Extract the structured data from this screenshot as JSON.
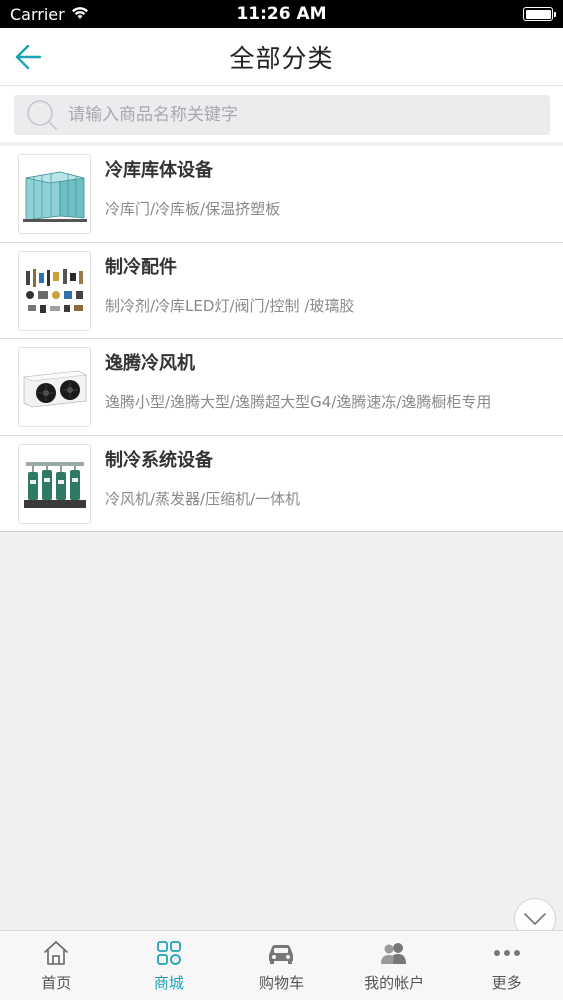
{
  "status_bar": {
    "carrier": "Carrier",
    "time": "11:26 AM"
  },
  "nav": {
    "title": "全部分类"
  },
  "search": {
    "placeholder": "请输入商品名称关键字"
  },
  "categories": [
    {
      "name": "冷库库体设备",
      "sub": "冷库门/冷库板/保温挤塑板",
      "icon": "cold-room-panels-image"
    },
    {
      "name": "制冷配件",
      "sub": "制冷剂/冷库LED灯/阀门/控制 /玻璃胶",
      "icon": "refrigeration-parts-image"
    },
    {
      "name": "逸腾冷风机",
      "sub": "逸腾小型/逸腾大型/逸腾超大型G4/逸腾速冻/逸腾橱柜专用",
      "icon": "air-cooler-image"
    },
    {
      "name": "制冷系统设备",
      "sub": "冷风机/蒸发器/压缩机/一体机",
      "icon": "compressor-unit-image"
    }
  ],
  "tabs": [
    {
      "label": "首页",
      "icon": "home-icon",
      "active": false
    },
    {
      "label": "商城",
      "icon": "grid-icon",
      "active": true
    },
    {
      "label": "购物车",
      "icon": "car-icon",
      "active": false
    },
    {
      "label": "我的帐户",
      "icon": "users-icon",
      "active": false
    },
    {
      "label": "更多",
      "icon": "more-icon",
      "active": false
    }
  ],
  "colors": {
    "accent": "#1ea3b3",
    "background": "#eef0f2"
  }
}
